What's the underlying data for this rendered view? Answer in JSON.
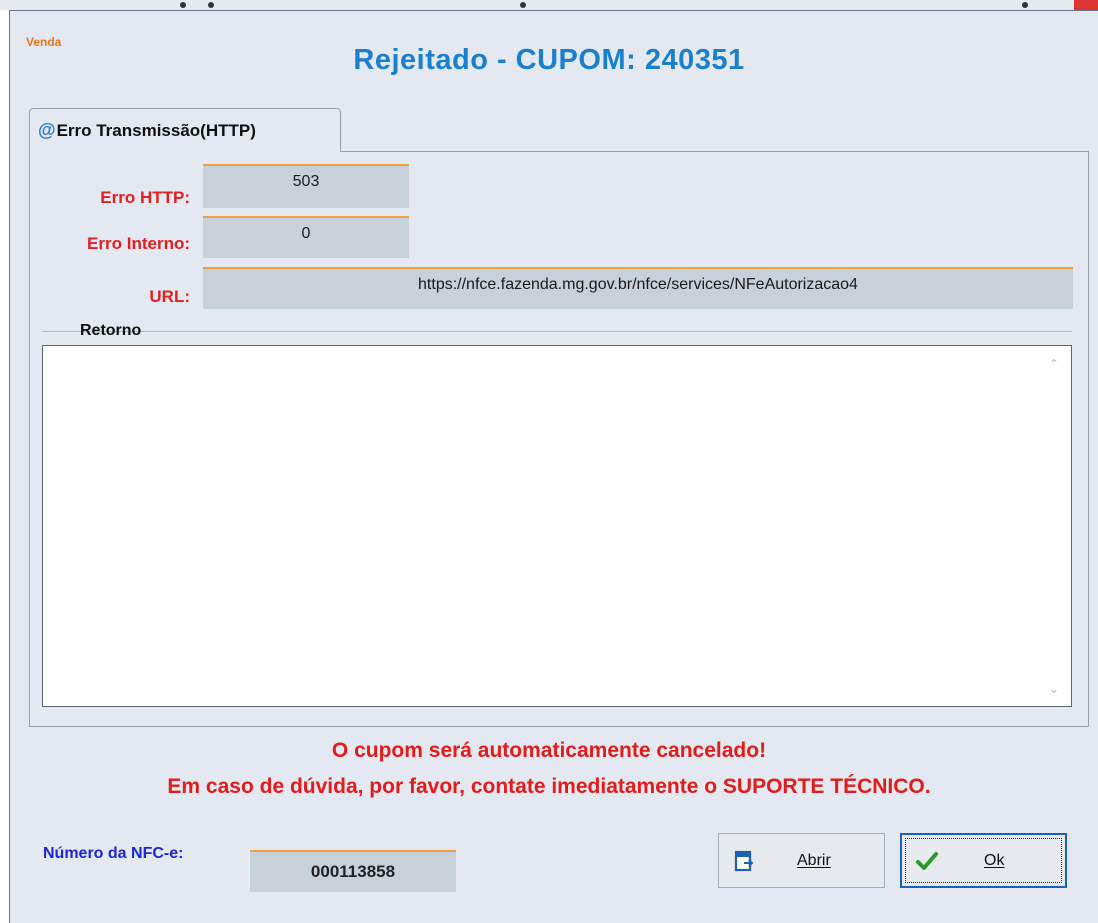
{
  "window": {
    "label": "Venda",
    "title": "Rejeitado - CUPOM: 240351"
  },
  "tab": {
    "icon": "at-icon",
    "label": "Erro Transmissão(HTTP)"
  },
  "fields": {
    "erro_http": {
      "label": "Erro HTTP:",
      "value": "503"
    },
    "erro_interno": {
      "label": "Erro Interno:",
      "value": "0"
    },
    "url": {
      "label": "URL:",
      "value": "https://nfce.fazenda.mg.gov.br/nfce/services/NFeAutorizacao4"
    }
  },
  "retorno": {
    "label": "Retorno",
    "value": ""
  },
  "message": {
    "line1": "O cupom será automaticamente cancelado!",
    "line2": "Em caso de dúvida, por favor, contate imediatamente o SUPORTE TÉCNICO."
  },
  "nfce": {
    "label": "Número da NFC-e:",
    "value": "000113858"
  },
  "buttons": {
    "abrir": {
      "label": "Abrir",
      "icon": "open-document-icon"
    },
    "ok": {
      "label": "Ok",
      "icon": "check-icon"
    }
  },
  "colors": {
    "title": "#1b7fd0",
    "label_red": "#e02020",
    "label_blue": "#1c26d6",
    "field_bg": "#c8d0da",
    "field_border": "#f0a043",
    "window_bg": "#e3e8f1",
    "check_green": "#2b9a2b"
  }
}
